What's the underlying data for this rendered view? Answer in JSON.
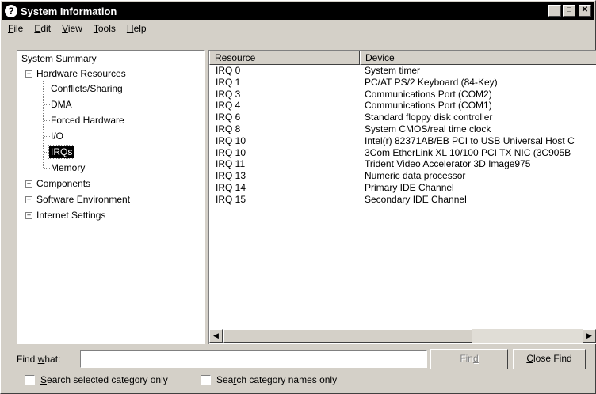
{
  "window": {
    "title": "System Information",
    "controls": {
      "minimize": "_",
      "maximize": "□",
      "close": "✕"
    }
  },
  "menu": [
    {
      "mnemonic": "F",
      "rest": "ile"
    },
    {
      "mnemonic": "E",
      "rest": "dit"
    },
    {
      "mnemonic": "V",
      "rest": "iew"
    },
    {
      "mnemonic": "T",
      "rest": "ools"
    },
    {
      "mnemonic": "H",
      "rest": "elp"
    }
  ],
  "tree": {
    "root": "System Summary",
    "hardware": "Hardware Resources",
    "hardware_children": [
      "Conflicts/Sharing",
      "DMA",
      "Forced Hardware",
      "I/O",
      "IRQs",
      "Memory"
    ],
    "selected": "IRQs",
    "components": "Components",
    "software": "Software Environment",
    "internet": "Internet Settings"
  },
  "list": {
    "columns": [
      "Resource",
      "Device"
    ],
    "rows": [
      [
        "IRQ 0",
        "System timer"
      ],
      [
        "IRQ 1",
        "PC/AT PS/2 Keyboard (84-Key)"
      ],
      [
        "IRQ 3",
        "Communications Port (COM2)"
      ],
      [
        "IRQ 4",
        "Communications Port (COM1)"
      ],
      [
        "IRQ 6",
        "Standard floppy disk controller"
      ],
      [
        "IRQ 8",
        "System CMOS/real time clock"
      ],
      [
        "IRQ 10",
        "Intel(r) 82371AB/EB PCI to USB Universal Host C"
      ],
      [
        "IRQ 10",
        "3Com EtherLink XL 10/100 PCI TX NIC (3C905B"
      ],
      [
        "IRQ 11",
        "Trident Video Accelerator 3D Image975"
      ],
      [
        "IRQ 13",
        "Numeric data processor"
      ],
      [
        "IRQ 14",
        "Primary IDE Channel"
      ],
      [
        "IRQ 15",
        "Secondary IDE Channel"
      ]
    ]
  },
  "find": {
    "label_pre": "Find ",
    "label_mnemonic": "w",
    "label_post": "hat:",
    "value": "",
    "find_pre": "Fin",
    "find_mnemonic": "d",
    "close_mnemonic": "C",
    "close_post": "lose Find",
    "chk1_mnemonic": "S",
    "chk1_post": "earch selected category only",
    "chk2_pre": "Sea",
    "chk2_mnemonic": "r",
    "chk2_post": "ch category names only"
  }
}
